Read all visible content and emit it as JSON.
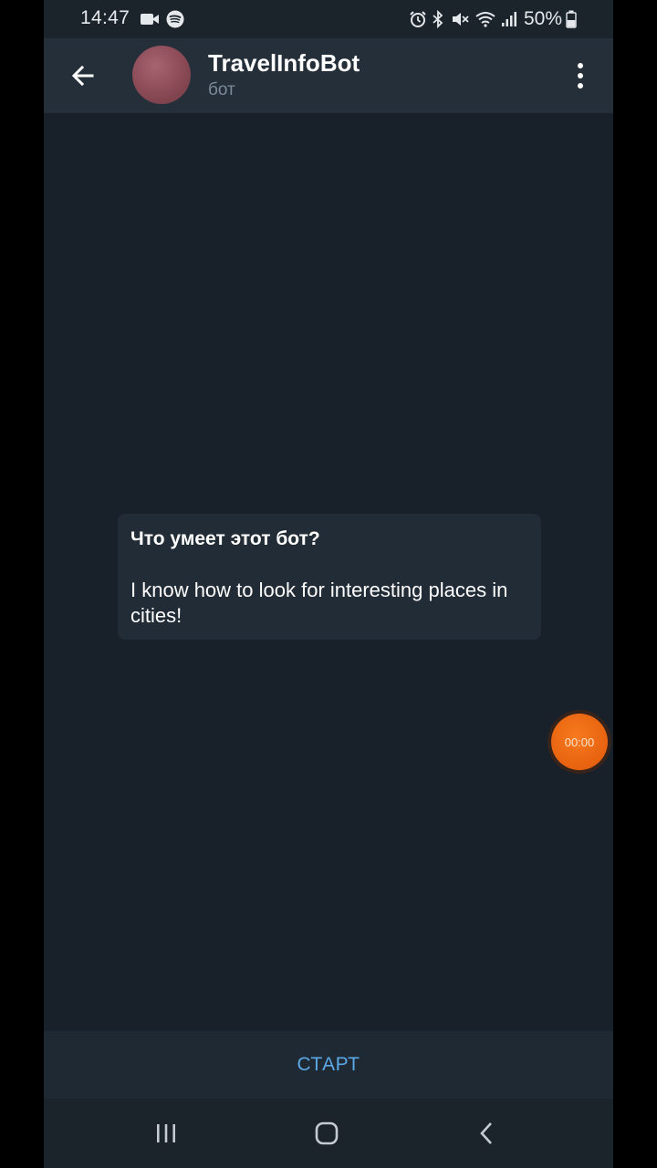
{
  "status_bar": {
    "time": "14:47",
    "battery": "50%",
    "icons": [
      "video-camera-icon",
      "spotify-icon",
      "alarm-icon",
      "bluetooth-icon",
      "mute-icon",
      "wifi-icon",
      "signal-icon",
      "battery-icon"
    ]
  },
  "header": {
    "title": "TravelInfoBot",
    "subtitle": "бот",
    "back_icon": "arrow-left-icon",
    "menu_icon": "more-vertical-icon"
  },
  "bot_info": {
    "title": "Что умеет этот бот?",
    "description": "I know how to look for interesting places in cities!"
  },
  "voice_badge": {
    "time": "00:00",
    "color": "#e8620f"
  },
  "start_button": {
    "label": "СТАРТ",
    "color": "#5aa9e6"
  },
  "nav_bar": {
    "icons": [
      "recent-apps-icon",
      "home-icon",
      "back-icon"
    ]
  }
}
